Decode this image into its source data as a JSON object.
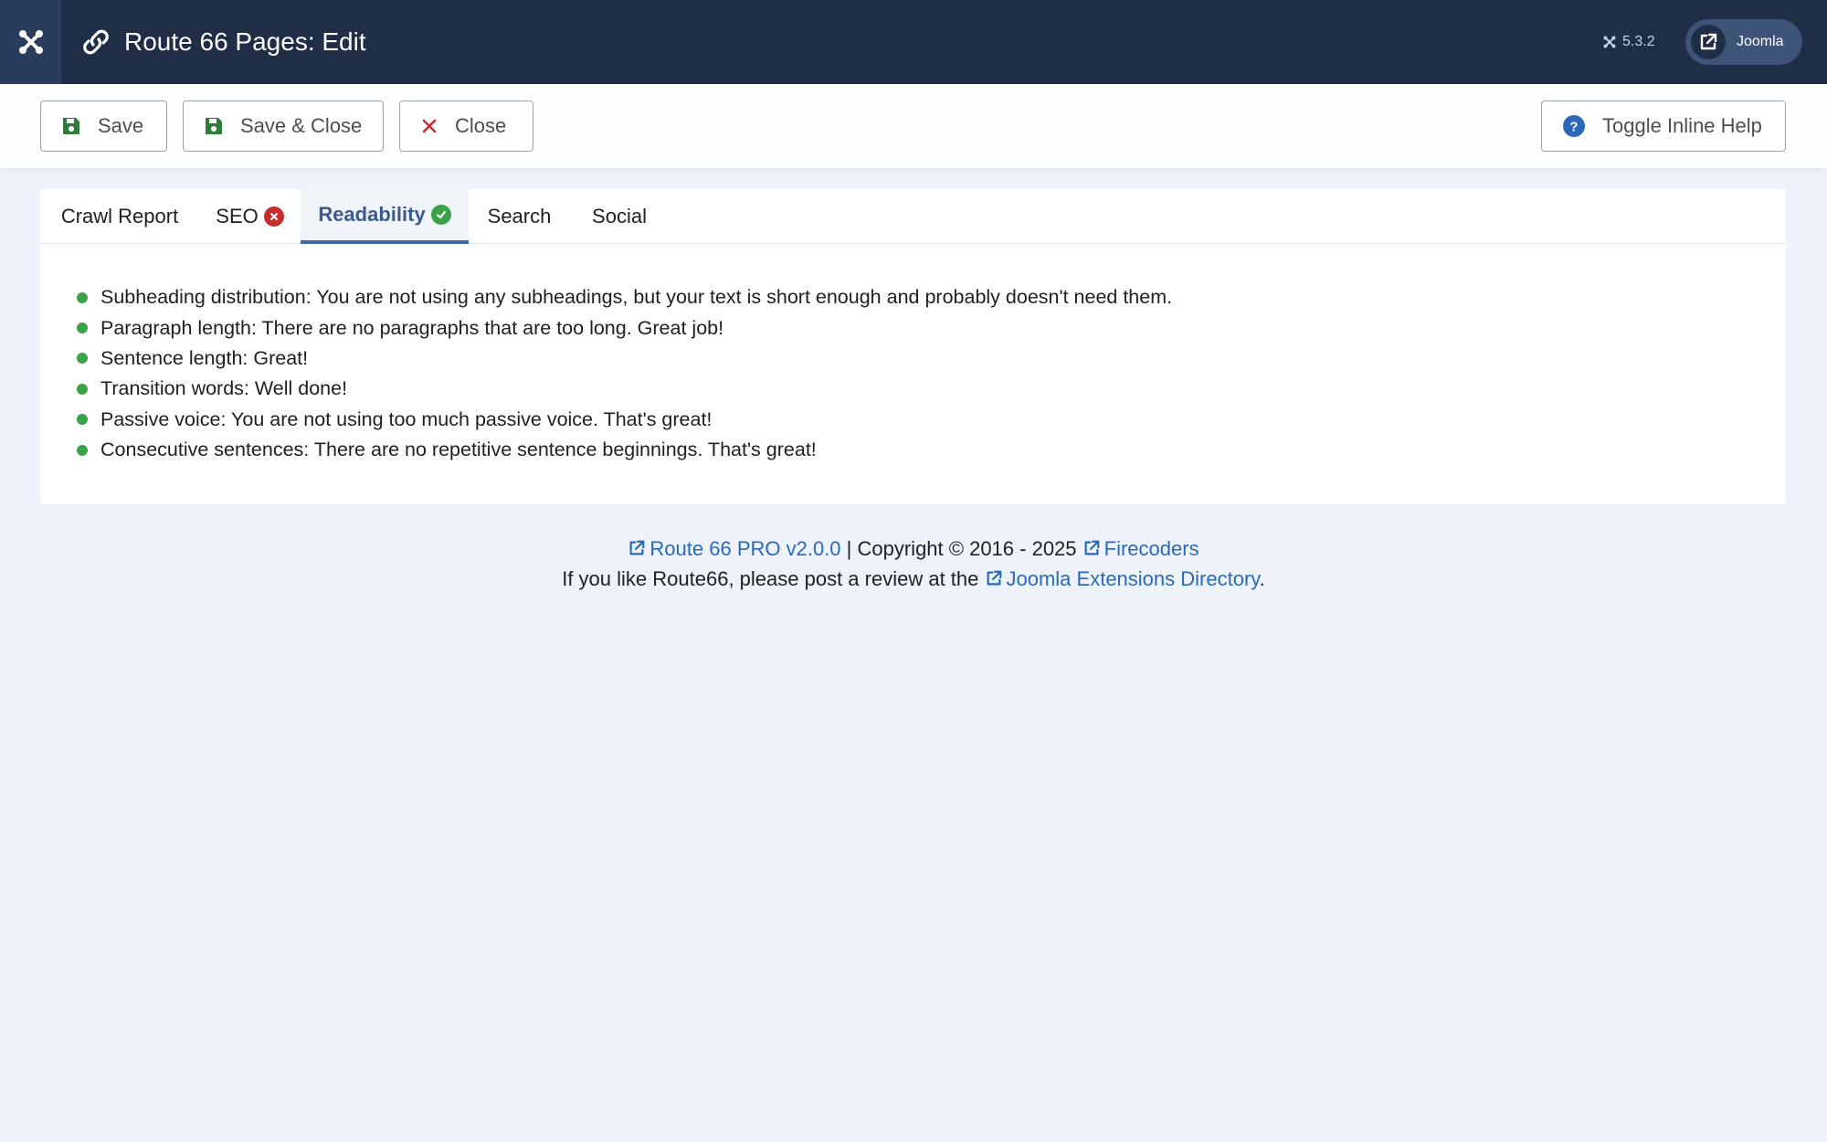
{
  "header": {
    "title": "Route 66 Pages: Edit",
    "version": "5.3.2",
    "site_link_label": "Joomla"
  },
  "toolbar": {
    "save_label": "Save",
    "save_close_label": "Save & Close",
    "close_label": "Close",
    "help_label": "Toggle Inline Help"
  },
  "tabs": [
    {
      "label": "Crawl Report"
    },
    {
      "label": "SEO",
      "status": "error"
    },
    {
      "label": "Readability",
      "status": "ok",
      "active": true
    },
    {
      "label": "Search"
    },
    {
      "label": "Social"
    }
  ],
  "readability": {
    "items": [
      "Subheading distribution: You are not using any subheadings, but your text is short enough and probably doesn't need them.",
      "Paragraph length: There are no paragraphs that are too long. Great job!",
      "Sentence length: Great!",
      "Transition words: Well done!",
      "Passive voice: You are not using too much passive voice. That's great!",
      "Consecutive sentences: There are no repetitive sentence beginnings. That's great!"
    ]
  },
  "footer": {
    "product_link": "Route 66 PRO v2.0.0",
    "copyright": "| Copyright © 2016 - 2025",
    "company_link": "Firecoders",
    "review_text": "If you like Route66, please post a review at the",
    "jed_link": "Joomla Extensions Directory",
    "period": "."
  },
  "colors": {
    "header_bg": "#1f2d47",
    "accent": "#3d6aa8",
    "success": "#3aa34a",
    "danger": "#c62d2d",
    "link": "#2a69b8",
    "page_bg": "#eef3fb"
  }
}
